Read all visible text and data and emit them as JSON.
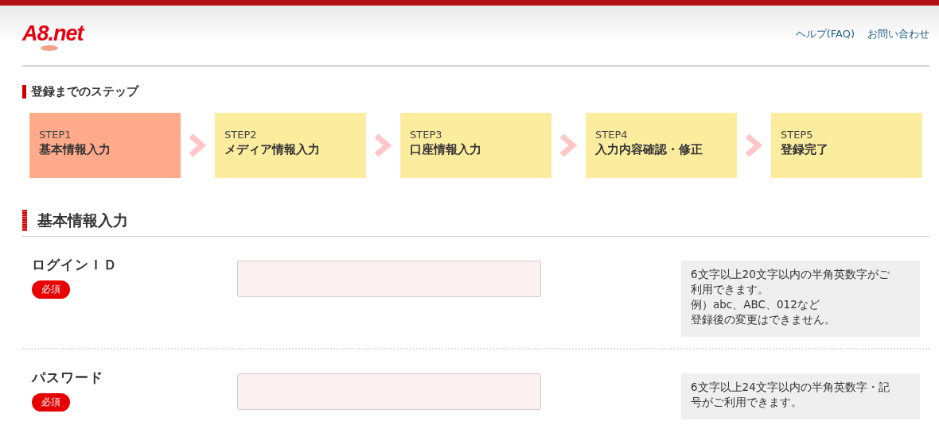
{
  "header": {
    "logo": "A8.net",
    "links": [
      "ヘルプ(FAQ)",
      "お問い合わせ"
    ]
  },
  "steps_title": "登録までのステップ",
  "steps": [
    {
      "number": "STEP1",
      "label": "基本情報入力",
      "selected": true
    },
    {
      "number": "STEP2",
      "label": "メディア情報入力",
      "selected": false
    },
    {
      "number": "STEP3",
      "label": "口座情報入力",
      "selected": false
    },
    {
      "number": "STEP4",
      "label": "入力内容確認・修正",
      "selected": false
    },
    {
      "number": "STEP5",
      "label": "登録完了",
      "selected": false
    }
  ],
  "section_title": "基本情報入力",
  "fields": [
    {
      "label": "ログインＩＤ",
      "badge": "必須",
      "note": [
        "6文字以上20文字以内の半角英数字がご",
        "利用できます。",
        "例）abc、ABC、012など",
        "登録後の変更はできません。"
      ]
    },
    {
      "label": "パスワード",
      "badge": "必須",
      "note": [
        "6文字以上24文字以内の半角英数字・記",
        "号がご利用できます。"
      ]
    }
  ]
}
